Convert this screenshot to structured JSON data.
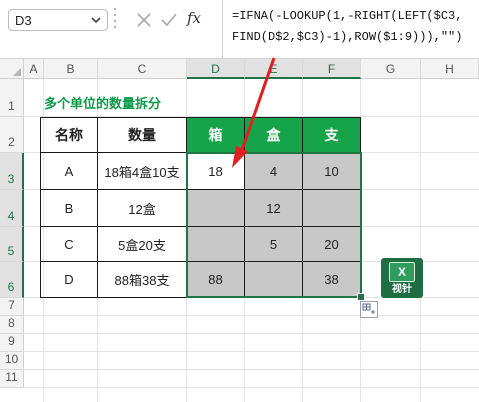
{
  "formula_bar": {
    "name_box": "D3",
    "fx_label": "fx",
    "formula_line1": "=IFNA(-LOOKUP(1,-RIGHT(LEFT($C3,",
    "formula_line2": "FIND(D$2,$C3)-1),ROW($1:9))),\"\")"
  },
  "columns": [
    "A",
    "B",
    "C",
    "D",
    "E",
    "F",
    "G",
    "H"
  ],
  "rows": [
    "1",
    "2",
    "3",
    "4",
    "5",
    "6",
    "7",
    "8",
    "9",
    "10",
    "11"
  ],
  "sheet_title": "多个单位的数量拆分",
  "table": {
    "headers": [
      "名称",
      "数量",
      "箱",
      "盒",
      "支"
    ],
    "rows": [
      {
        "name": "A",
        "qty": "18箱4盒10支",
        "box": "18",
        "case": "4",
        "unit": "10"
      },
      {
        "name": "B",
        "qty": "12盒",
        "box": "",
        "case": "12",
        "unit": ""
      },
      {
        "name": "C",
        "qty": "5盒20支",
        "box": "",
        "case": "5",
        "unit": "20"
      },
      {
        "name": "D",
        "qty": "88箱38支",
        "box": "88",
        "case": "",
        "unit": "38"
      }
    ]
  },
  "logo": {
    "glyph": "X",
    "label": "视针"
  },
  "colors": {
    "accent": "#217346",
    "header_green": "#17a34a",
    "title_green": "#0c9a4a",
    "arrow_red": "#e02020",
    "gray_cell": "#c8c8c8"
  }
}
